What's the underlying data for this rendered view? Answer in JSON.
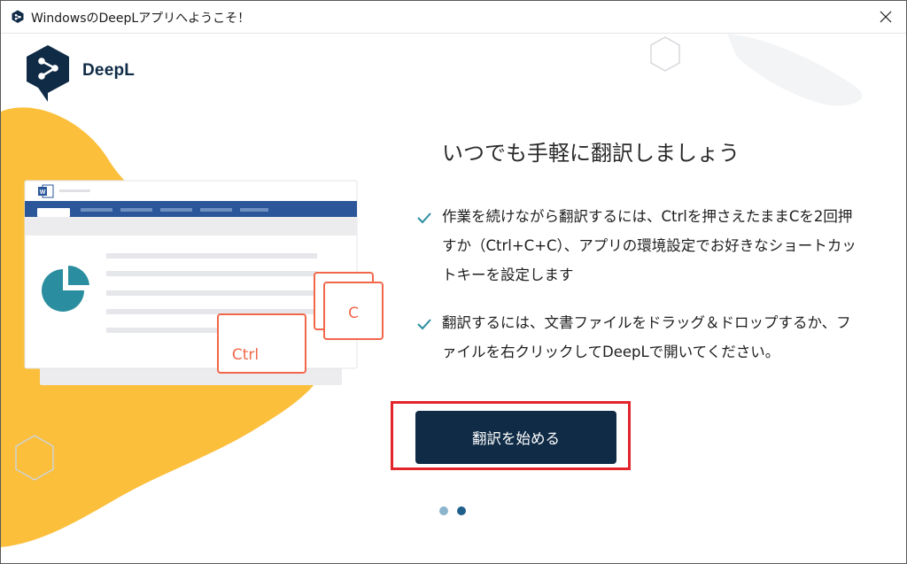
{
  "window": {
    "title": "WindowsのDeepLアプリへようこそ！",
    "close_glyph": "✕"
  },
  "brand": {
    "name": "DeepL",
    "navy": "#0f2b46",
    "accent_yellow": "#fbbf3b",
    "accent_coral": "#f2674a",
    "teal": "#2a8ea0",
    "highlight_red": "#e3242b"
  },
  "main": {
    "headline": "いつでも手軽に翻訳しましょう",
    "bullets": [
      {
        "text": "作業を続けながら翻訳するには、Ctrlを押さえたままCを2回押すか（Ctrl+C+C）、アプリの環境設定でお好きなショートカットキーを設定します"
      },
      {
        "text": "翻訳するには、文書ファイルをドラッグ＆ドロップするか、ファイルを右クリックしてDeepLで開いてください。"
      }
    ],
    "start_button": "翻訳を始める"
  },
  "illustration": {
    "key_ctrl": "Ctrl",
    "key_c": "C",
    "doc_icon_letter": "W"
  },
  "pagination": {
    "total": 2,
    "active_index": 1
  },
  "icons": [
    "deepl-logo-icon",
    "check-icon",
    "close-icon",
    "pie-chart-icon",
    "word-doc-icon",
    "hexagon-icon"
  ]
}
